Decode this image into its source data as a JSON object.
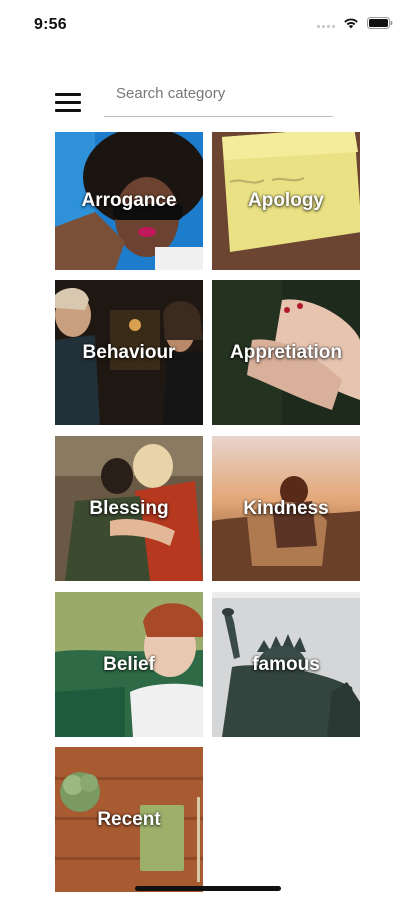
{
  "status_bar": {
    "time": "9:56"
  },
  "search": {
    "placeholder": "Search category"
  },
  "categories": [
    {
      "label": "Arrogance"
    },
    {
      "label": "Apology"
    },
    {
      "label": "Behaviour"
    },
    {
      "label": "Appretiation"
    },
    {
      "label": "Blessing"
    },
    {
      "label": "Kindness"
    },
    {
      "label": "Belief"
    },
    {
      "label": "famous"
    },
    {
      "label": "Recent"
    }
  ],
  "icons": {
    "menu": "hamburger-menu-icon",
    "wifi": "wifi-icon",
    "battery": "battery-icon",
    "signal": "signal-icon"
  }
}
